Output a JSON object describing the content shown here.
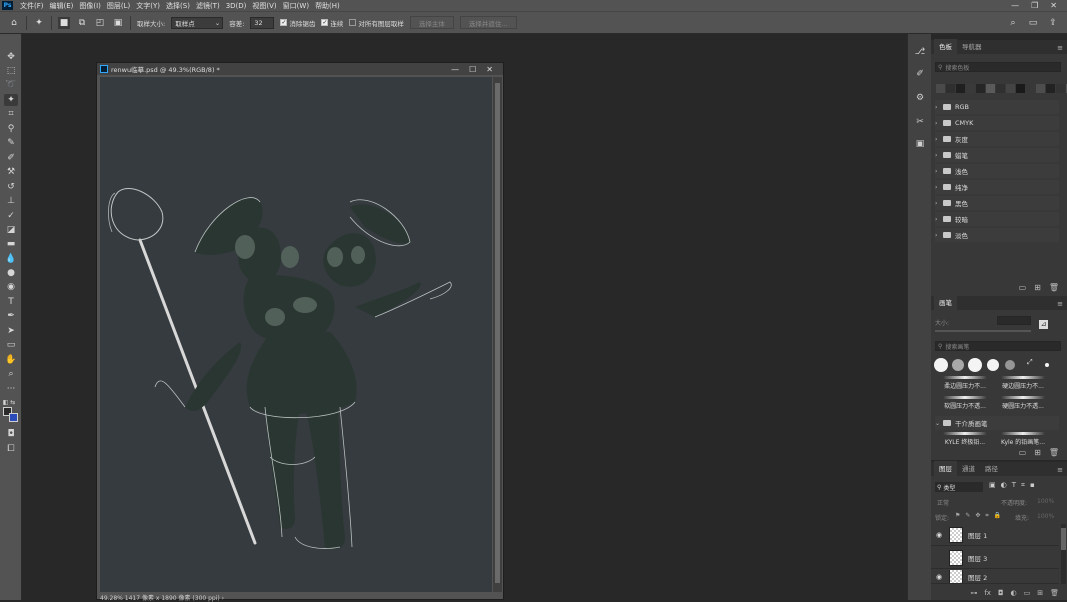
{
  "menubar": {
    "logo": "Ps",
    "items": [
      "文件(F)",
      "编辑(E)",
      "图像(I)",
      "图层(L)",
      "文字(Y)",
      "选择(S)",
      "滤镜(T)",
      "3D(D)",
      "视图(V)",
      "窗口(W)",
      "帮助(H)"
    ],
    "window_controls": [
      "—",
      "❐",
      "✕"
    ]
  },
  "options": {
    "sample_size_label": "取样大小:",
    "sample_size_value": "取样点",
    "tolerance_label": "容差:",
    "tolerance_value": "32",
    "antialias_label": "消除锯齿",
    "contiguous_label": "连续",
    "sample_all_label": "对所有图层取样",
    "select_subject_label": "选择主体",
    "select_and_mask_label": "选择并遮住..."
  },
  "document": {
    "title": "renwu临摹.psd @ 49.3%(RGB/8) *",
    "window_controls": [
      "—",
      "☐",
      "✕"
    ],
    "status": "49.28%     1417 像素 x 1890 像素 (300 ppi)    ›"
  },
  "swatches_panel": {
    "tabs": [
      "色板",
      "导航器"
    ],
    "search_placeholder": "搜索色板",
    "colors": [
      "#4a4a4a",
      "#2f2f2f",
      "#1f1f1f",
      "#3a3a3a",
      "#262626",
      "#5a5a5a",
      "#303030",
      "#444444",
      "#1a1a1a",
      "#383838",
      "#4d4d4d",
      "#222222",
      "#333333",
      "#555555",
      "#2a2a2a"
    ],
    "folders": [
      "RGB",
      "CMYK",
      "灰度",
      "蜡笔",
      "浅色",
      "纯净",
      "黑色",
      "较暗",
      "淡色"
    ]
  },
  "brushes_panel": {
    "tab": "画笔",
    "size_label": "大小:",
    "search_placeholder": "搜索画笔",
    "presets": [
      "柔边圆压力不...",
      "硬边圆压力不...",
      "软圆压力不透...",
      "硬圆压力不透..."
    ],
    "group": "干介质画笔",
    "group_items": [
      "KYLE 终极铅...",
      "Kyle 的铅画笔..."
    ]
  },
  "layers_panel": {
    "tabs": [
      "图层",
      "通道",
      "路径"
    ],
    "kind_label": "类型",
    "blend_mode": "正常",
    "opacity_label": "不透明度:",
    "opacity_value": "100%",
    "lock_label": "锁定:",
    "fill_label": "填充:",
    "fill_value": "100%",
    "layers": [
      {
        "name": "图层 1",
        "visible": true
      },
      {
        "name": "图层 3",
        "visible": false
      },
      {
        "name": "图层 2",
        "visible": true
      }
    ]
  }
}
